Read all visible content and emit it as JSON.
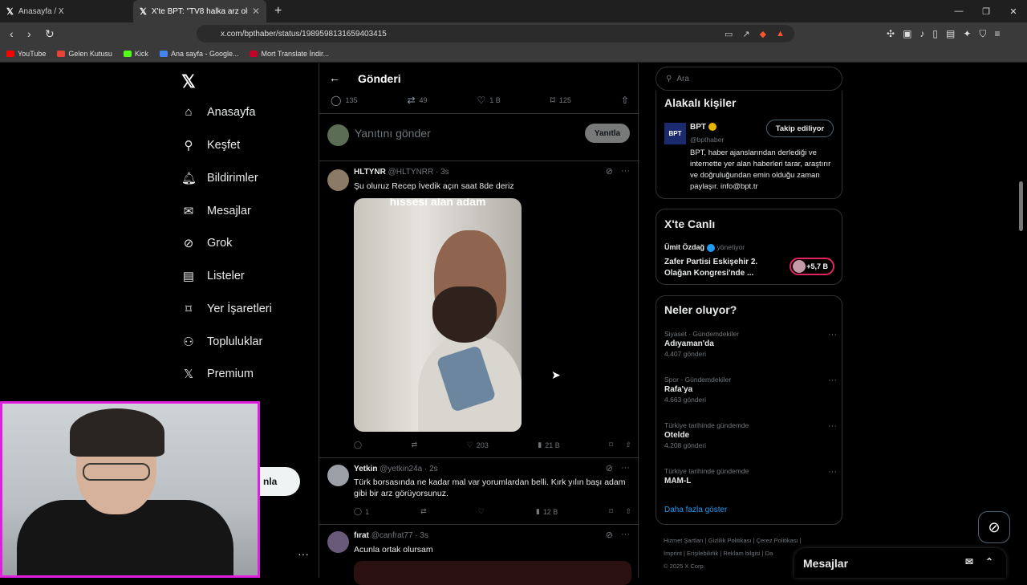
{
  "browser": {
    "tabs": [
      {
        "title": "Anasayfa / X"
      },
      {
        "title": "X'te BPT: \"TV8 halka arz oluyor. I"
      }
    ],
    "new_tab": "+",
    "url": "x.com/bpthaber/status/1989598131659403415",
    "bookmarks": [
      {
        "label": "YouTube",
        "color": "#ff0000"
      },
      {
        "label": "Gelen Kutusu",
        "color": "#ea4335"
      },
      {
        "label": "Kick",
        "color": "#53fc18"
      },
      {
        "label": "Ana sayfa - Google...",
        "color": "#4285f4"
      },
      {
        "label": "Mort Translate İndir...",
        "color": "#c4002b"
      }
    ]
  },
  "sidebar": {
    "items": [
      {
        "label": "Anasayfa",
        "icon": "home-icon"
      },
      {
        "label": "Keşfet",
        "icon": "search-icon"
      },
      {
        "label": "Bildirimler",
        "icon": "bell-icon"
      },
      {
        "label": "Mesajlar",
        "icon": "mail-icon"
      },
      {
        "label": "Grok",
        "icon": "grok-icon"
      },
      {
        "label": "Listeler",
        "icon": "list-icon"
      },
      {
        "label": "Yer İşaretleri",
        "icon": "bookmark-icon"
      },
      {
        "label": "Topluluklar",
        "icon": "communities-icon"
      },
      {
        "label": "Premium",
        "icon": "x-icon"
      }
    ],
    "post_button_partial": "nla"
  },
  "main": {
    "title": "Gönderi",
    "actions": {
      "replies": "135",
      "reposts": "49",
      "likes": "1 B",
      "bookmarks": "125"
    },
    "reply_placeholder": "Yanıtını gönder",
    "reply_button": "Yanıtla",
    "tweets": [
      {
        "name": "HLTYNR",
        "handle": "@HLTYNRR · 3s",
        "text": "Şu oluruz Recep İvedik açın saat 8de deriz",
        "media_caption": "hissesi alan adam",
        "likes": "203",
        "views": "21 B",
        "replies": "",
        "reposts": ""
      },
      {
        "name": "Yetkin",
        "handle": "@yetkin24a · 2s",
        "text": "Türk borsasında ne kadar mal var yorumlardan belli. Kırk yılın başı adam gibi bir arz görüyorsunuz.",
        "replies": "1",
        "likes": "",
        "views": "12 B"
      },
      {
        "name": "fırat",
        "handle": "@canfrat77 · 3s",
        "text": "Acunla ortak olursam"
      }
    ]
  },
  "right": {
    "search_placeholder": "Ara",
    "related": {
      "title": "Alakalı kişiler",
      "name": "BPT",
      "handle": "@bpthaber",
      "follow_label": "Takip ediliyor",
      "bio": "BPT, haber ajanslarından derlediği ve internette yer alan haberleri tarar, araştırır ve doğruluğundan emin olduğu zaman paylaşır. info@bpt.tr"
    },
    "live": {
      "title": "X'te Canlı",
      "host": "Ümit Özdağ",
      "host_suffix": "yönetiyor",
      "event": "Zafer Partisi Eskişehir 2. Olağan Kongresi'nde ...",
      "count": "+5,7 B"
    },
    "trends": {
      "title": "Neler oluyor?",
      "items": [
        {
          "context": "Siyaset · Gündemdekiler",
          "name": "Adıyaman'da",
          "count": "4.407 gönderi"
        },
        {
          "context": "Spor · Gündemdekiler",
          "name": "Rafa'ya",
          "count": "4.663 gönderi"
        },
        {
          "context": "Türkiye tarihinde gündemde",
          "name": "Otelde",
          "count": "4.208 gönderi"
        },
        {
          "context": "Türkiye tarihinde gündemde",
          "name": "MAM-L",
          "count": ""
        }
      ],
      "show_more": "Daha fazla göster"
    },
    "footer": {
      "line1": "Hizmet Şartları  |  Gizlilik Politikası  |  Çerez Politikası  |",
      "line2": "İmprint  |  Erişilebilirlik  |  Reklam bilgisi  |  Da",
      "line3": "© 2025 X Corp."
    }
  },
  "messages_drawer": {
    "title": "Mesajlar"
  }
}
